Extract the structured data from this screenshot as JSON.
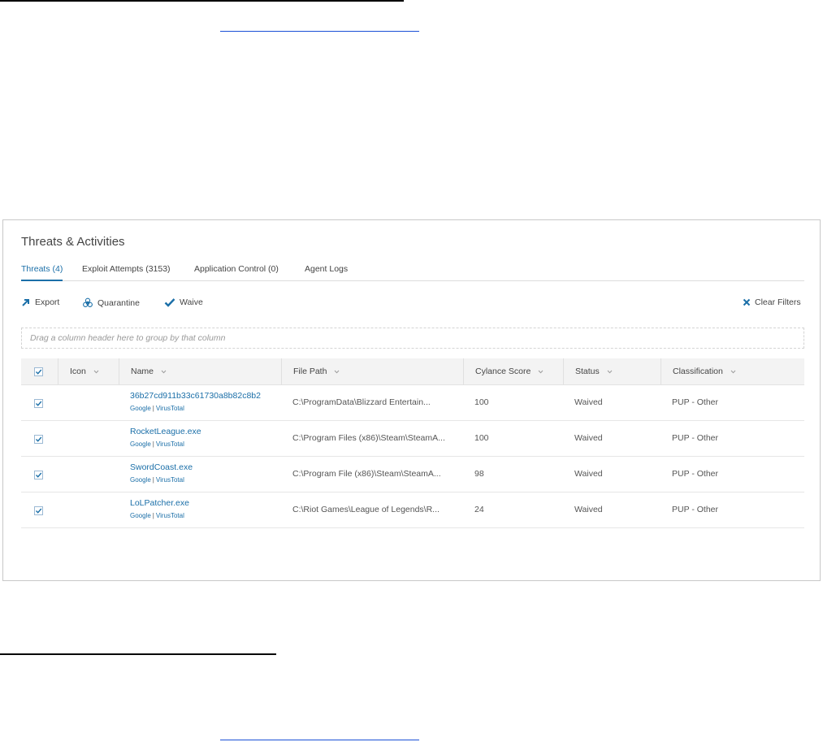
{
  "panel": {
    "title": "Threats & Activities",
    "tabs": [
      {
        "label": "Threats (4)",
        "active": true
      },
      {
        "label": "Exploit Attempts (3153)",
        "active": false
      },
      {
        "label": "Application Control (0)",
        "active": false
      },
      {
        "label": "Agent Logs",
        "active": false
      }
    ],
    "toolbar": {
      "export_label": "Export",
      "quarantine_label": "Quarantine",
      "waive_label": "Waive",
      "clear_filters_label": "Clear Filters"
    },
    "group_bar_hint": "Drag a column header here to group by that column",
    "columns": [
      "Icon",
      "Name",
      "File Path",
      "Cylance Score",
      "Status",
      "Classification"
    ],
    "rows": [
      {
        "name": "36b27cd911b33c61730a8b82c8b2",
        "google": "Google",
        "virustotal": "VirusTotal",
        "file_path": "C:\\ProgramData\\Blizzard Entertain...",
        "score": "100",
        "status": "Waived",
        "classification": "PUP - Other"
      },
      {
        "name": "RocketLeague.exe",
        "google": "Google",
        "virustotal": "VirusTotal",
        "file_path": "C:\\Program Files (x86)\\Steam\\SteamA...",
        "score": "100",
        "status": "Waived",
        "classification": "PUP - Other"
      },
      {
        "name": "SwordCoast.exe",
        "google": "Google",
        "virustotal": "VirusTotal",
        "file_path": "C:\\Program File (x86)\\Steam\\SteamA...",
        "score": "98",
        "status": "Waived",
        "classification": "PUP - Other"
      },
      {
        "name": "LoLPatcher.exe",
        "google": "Google",
        "virustotal": "VirusTotal",
        "file_path": "C:\\Riot Games\\League of Legends\\R...",
        "score": "24",
        "status": "Waived",
        "classification": "PUP - Other"
      }
    ]
  },
  "colors": {
    "accent": "#1b6fa8",
    "header_bg": "#f3f3f3"
  }
}
